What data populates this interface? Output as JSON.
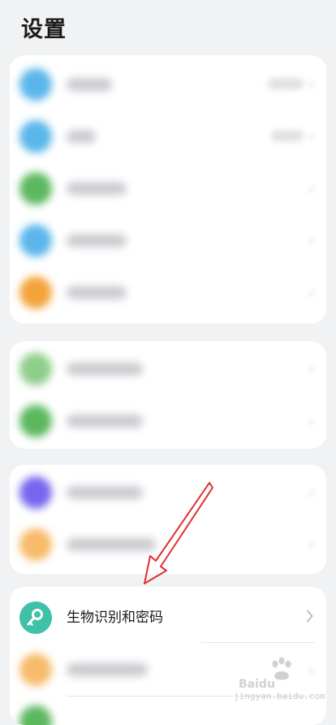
{
  "page": {
    "title": "设置"
  },
  "featured_item": {
    "label": "生物识别和密码",
    "icon": "key-icon",
    "accent": "#3fc1a8"
  },
  "group_colors": {
    "blue": "#5ab6ea",
    "green": "#5cb85f",
    "orange": "#f4a33a",
    "purple": "#7766ee",
    "light_orange": "#f7bb6a",
    "light_green": "#8fcd8a"
  },
  "watermark": {
    "text": "jingyan.baidu.com",
    "brand": "Baidu"
  }
}
